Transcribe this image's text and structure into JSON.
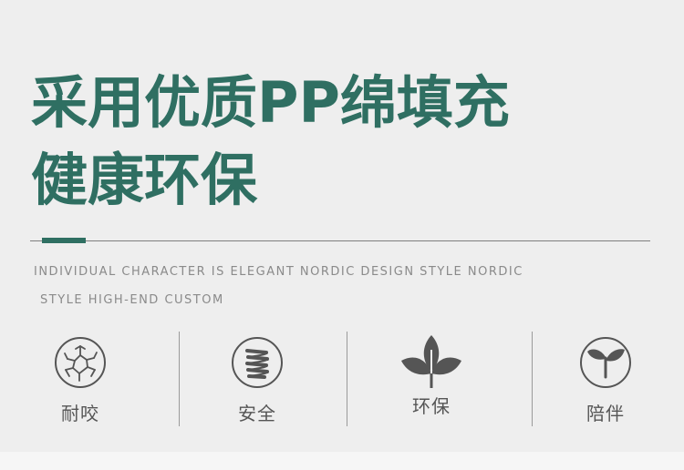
{
  "headline": {
    "line1": "采用优质PP绵填充",
    "line2": "健康环保"
  },
  "subtitle": {
    "line1": "INDIVIDUAL CHARACTER IS ELEGANT NORDIC DESIGN STYLE NORDIC",
    "line2": "STYLE HIGH-END CUSTOM"
  },
  "features": [
    {
      "label": "耐咬",
      "icon": "cracked-circle-icon"
    },
    {
      "label": "安全",
      "icon": "spring-coil-icon"
    },
    {
      "label": "环保",
      "icon": "leaves-icon"
    },
    {
      "label": "陪伴",
      "icon": "sprout-icon"
    }
  ],
  "colors": {
    "accent": "#2f6f62",
    "background": "#eeeeee",
    "text_gray": "#8a8a8a",
    "icon_gray": "#555555"
  }
}
